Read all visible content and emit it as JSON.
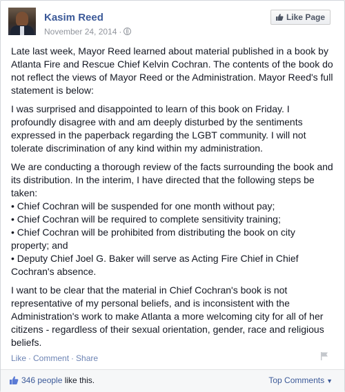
{
  "post": {
    "author": "Kasim Reed",
    "date": "November 24, 2014",
    "privacy_icon": "globe-icon",
    "like_page_label": "Like Page",
    "paragraphs": [
      "Late last week, Mayor Reed learned about material published in a book by Atlanta Fire and Rescue Chief Kelvin Cochran. The contents of the book do not reflect the views of Mayor Reed or the Administration. Mayor Reed's full statement is below:",
      "I was surprised and disappointed to learn of this book on Friday. I profoundly disagree with and am deeply disturbed by the sentiments expressed in the paperback regarding the LGBT community. I will not tolerate discrimination of any kind within my administration.",
      "We are conducting a thorough review of the facts surrounding the book and its distribution. In the interim, I have directed that the following steps be taken:"
    ],
    "steps": [
      "• Chief Cochran will be suspended for one month without pay;",
      "• Chief Cochran will be required to complete sensitivity training;",
      "• Chief Cochran will be prohibited from distributing the book on city property; and",
      "• Deputy Chief Joel G. Baker will serve as Acting Fire Chief in Chief Cochran's absence."
    ],
    "closing": "I want to be clear that the material in Chief Cochran's book is not representative of my personal beliefs, and is inconsistent with the Administration's work to make Atlanta a more welcoming city for all of her citizens - regardless of their sexual orientation, gender, race and religious beliefs."
  },
  "actions": {
    "like": "Like",
    "comment": "Comment",
    "share": "Share",
    "separator": "·"
  },
  "footer": {
    "likes_count": "346 people",
    "likes_suffix": " like this.",
    "top_comments": "Top Comments"
  },
  "colors": {
    "link": "#3b5998",
    "action_link": "#6d84b4",
    "meta": "#90949c"
  }
}
